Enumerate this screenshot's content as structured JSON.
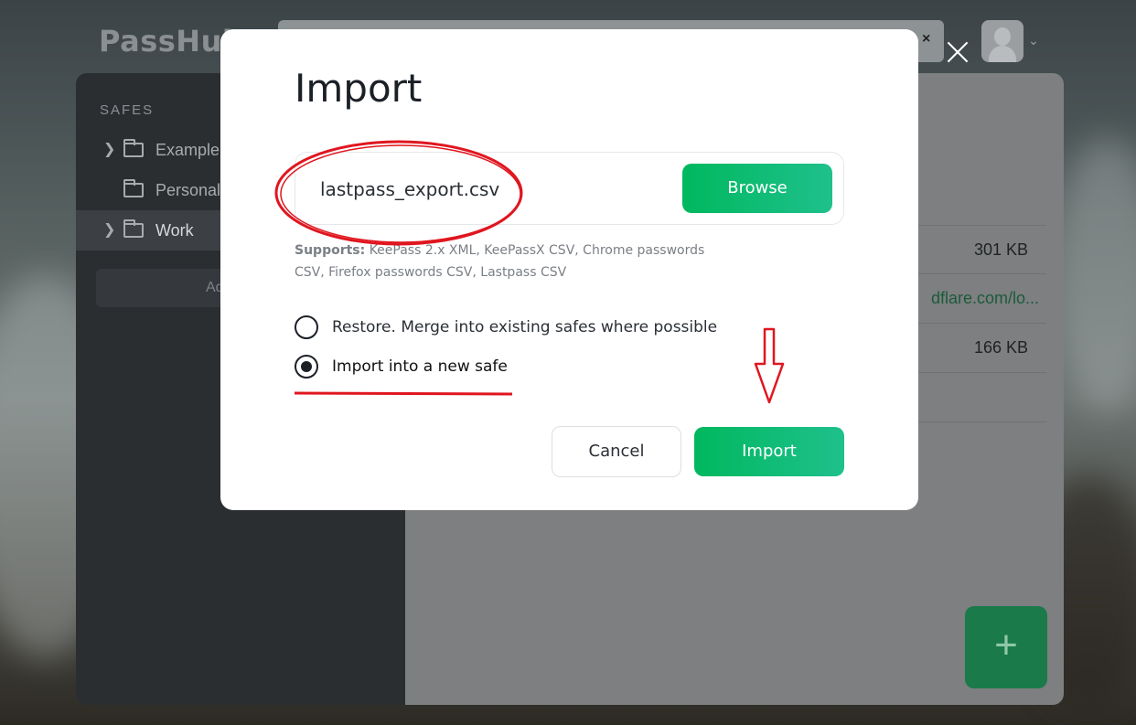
{
  "app": {
    "logo": "PassHub",
    "search_clear": "×"
  },
  "sidebar": {
    "section_label": "SAFES",
    "items": [
      {
        "label": "Example",
        "expandable": true,
        "active": false
      },
      {
        "label": "Personal",
        "expandable": false,
        "active": false
      },
      {
        "label": "Work",
        "expandable": true,
        "active": true
      }
    ],
    "add_button_label": "Ad"
  },
  "main": {
    "rows": [
      {
        "value": "301 KB"
      },
      {
        "link": "dflare.com/lo..."
      },
      {
        "value": "166 KB"
      }
    ]
  },
  "modal": {
    "title": "Import",
    "file_name": "lastpass_export.csv",
    "browse_label": "Browse",
    "supports_label": "Supports:",
    "supports_text": " KeePass 2.x XML, KeePassX CSV, Chrome passwords CSV, Firefox passwords CSV, Lastpass CSV",
    "options": [
      {
        "label": "Restore. Merge into existing safes where possible",
        "checked": false
      },
      {
        "label": "Import into a new safe",
        "checked": true
      }
    ],
    "cancel_label": "Cancel",
    "import_label": "Import"
  },
  "colors": {
    "accent_green": "#00b85e",
    "annotation_red": "#e0161f",
    "sidebar_bg": "#2b2e31"
  }
}
